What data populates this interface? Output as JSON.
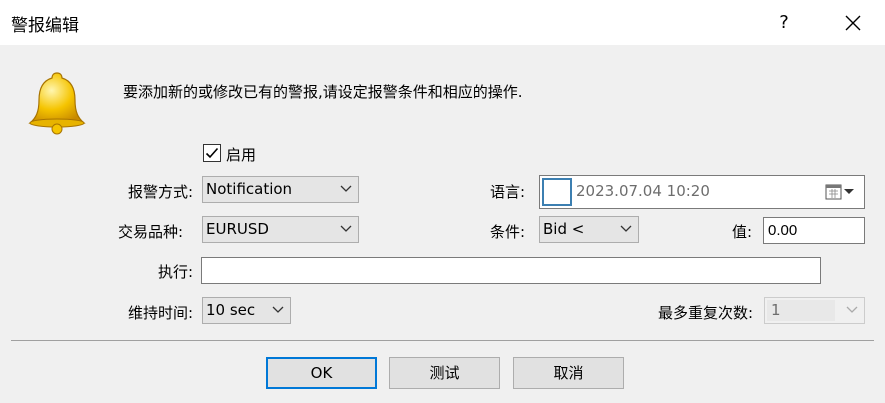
{
  "window": {
    "title": "警报编辑",
    "help_label": "?"
  },
  "intro_text": "要添加新的或修改已有的警报,请设定报警条件和相应的操作.",
  "enable": {
    "label": "启用",
    "checked": true
  },
  "alert_type": {
    "label": "报警方式:",
    "value": "Notification"
  },
  "symbol": {
    "label": "交易品种:",
    "value": "EURUSD"
  },
  "execute": {
    "label": "执行:",
    "value": ""
  },
  "hold_time": {
    "label": "维持时间:",
    "value": "10 sec"
  },
  "language": {
    "label": "语言:",
    "value": "2023.07.04 10:20"
  },
  "condition": {
    "label": "条件:",
    "value": "Bid <"
  },
  "value_field": {
    "label": "值:",
    "value": "0.00"
  },
  "max_repeats": {
    "label": "最多重复次数:",
    "value": "1"
  },
  "buttons": {
    "ok": "OK",
    "test": "测试",
    "cancel": "取消"
  },
  "colors": {
    "default_button_border": "#0078d7",
    "bell": "#f5c400"
  }
}
